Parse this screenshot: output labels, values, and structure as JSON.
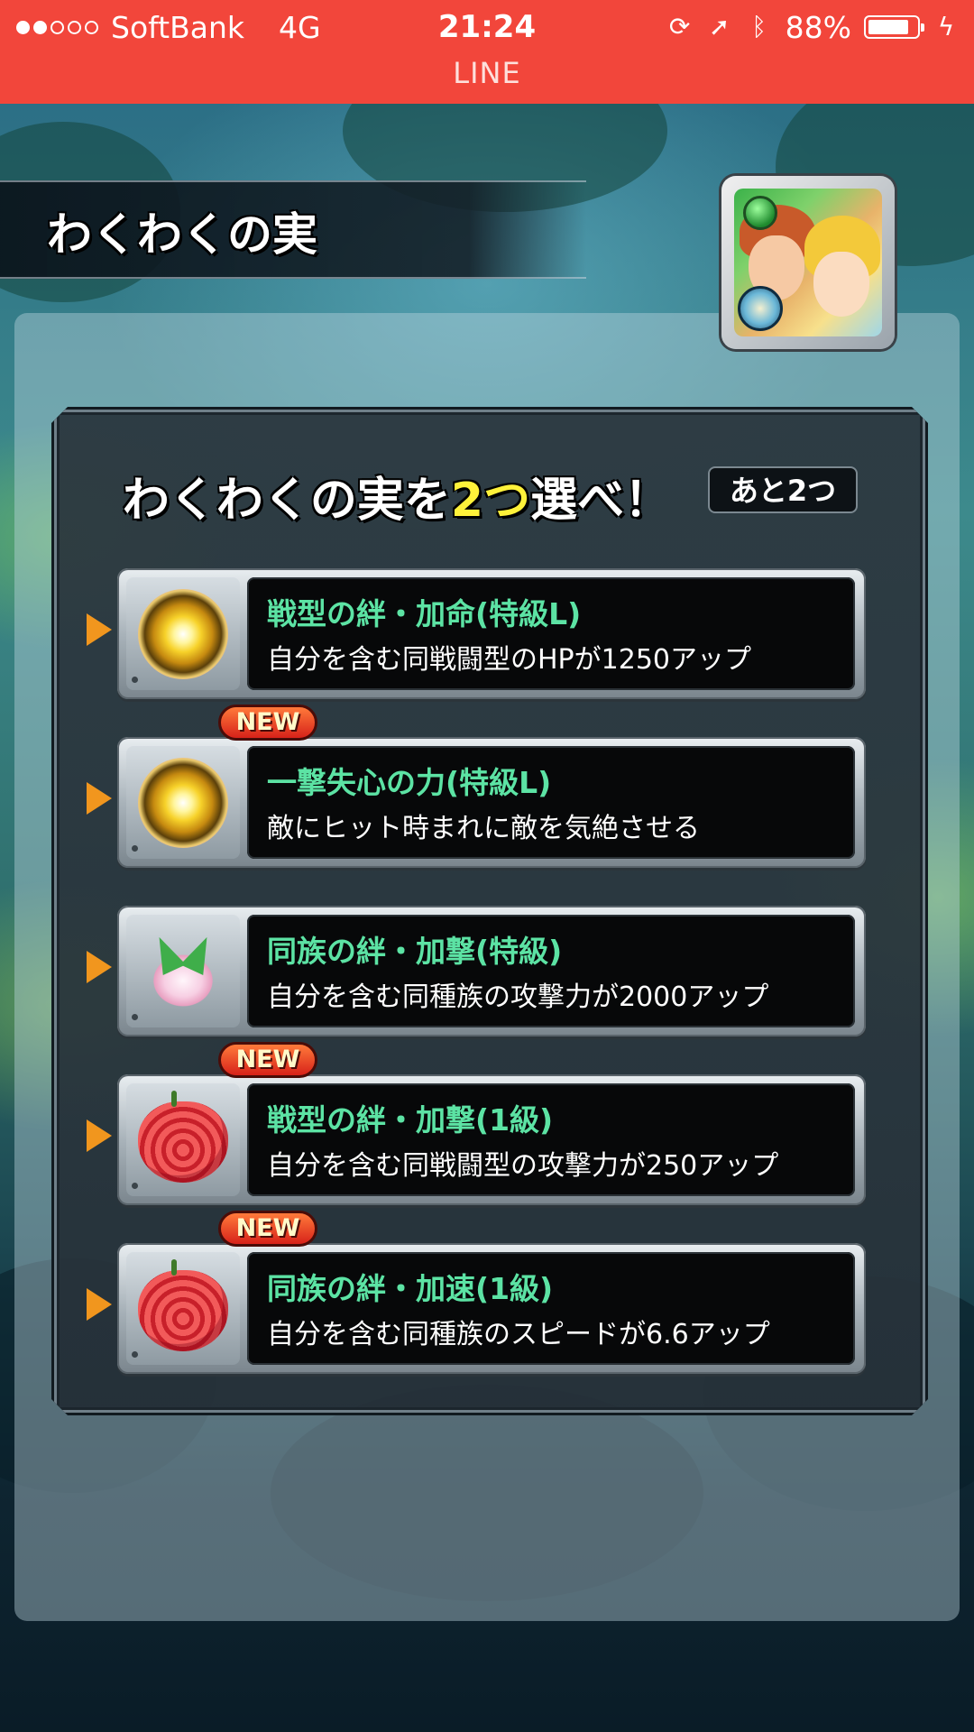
{
  "status_bar": {
    "carrier": "SoftBank",
    "network": "4G",
    "time": "21:24",
    "battery_text": "88%",
    "battery_level": 0.88,
    "app_name": "LINE",
    "bg_color": "#f2463b"
  },
  "screen": {
    "title": "わくわくの実",
    "heading_before": "わくわくの実を",
    "heading_highlight": "2つ",
    "heading_after": "選べ！",
    "remaining": "あと2つ"
  },
  "options": [
    {
      "title": "戦型の絆・加命(特級L)",
      "description": "自分を含む同戦闘型のHPが1250アップ",
      "is_new": false,
      "icon": "sun-orb-icon"
    },
    {
      "title": "一撃失心の力(特級L)",
      "description": "敵にヒット時まれに敵を気絶させる",
      "is_new": true,
      "icon": "sun-orb-icon"
    },
    {
      "title": "同族の絆・加撃(特級)",
      "description": "自分を含む同種族の攻撃力が2000アップ",
      "is_new": false,
      "icon": "crystal-flower-icon"
    },
    {
      "title": "戦型の絆・加撃(1級)",
      "description": "自分を含む同戦闘型の攻撃力が250アップ",
      "is_new": true,
      "icon": "red-fruit-icon"
    },
    {
      "title": "同族の絆・加速(1級)",
      "description": "自分を含む同種族のスピードが6.6アップ",
      "is_new": true,
      "icon": "red-fruit-icon"
    }
  ],
  "new_label": "NEW"
}
